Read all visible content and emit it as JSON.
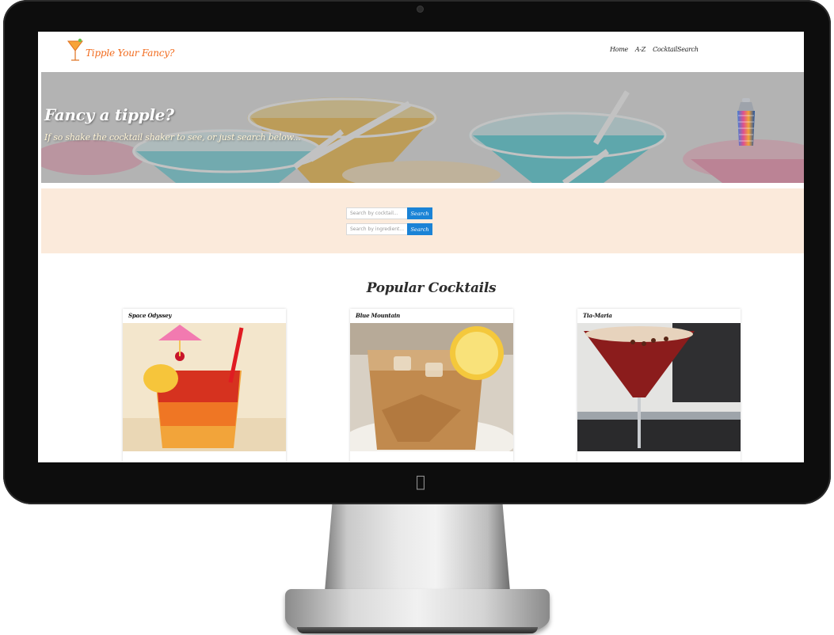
{
  "brand": {
    "logo_text": "Tipple Your Fancy?",
    "accent": "#f26b1d"
  },
  "nav": {
    "items": [
      "Home",
      "A-Z",
      "CocktailSearch"
    ]
  },
  "hero": {
    "title": "Fancy a tipple?",
    "subtitle": "If so shake the cocktail shaker to see, or just search below..."
  },
  "search": {
    "cocktail_placeholder": "Search by cocktail...",
    "ingredient_placeholder": "Search by ingredient...",
    "button_label": "Search",
    "button_color": "#1a83d6",
    "band_color": "#fbeadb"
  },
  "popular": {
    "heading": "Popular Cocktails",
    "cards": [
      {
        "title": "Space Odyssey"
      },
      {
        "title": "Blue Mountain"
      },
      {
        "title": "Tia-Maria"
      }
    ]
  },
  "icons": {
    "logo": "cocktail-glass-icon",
    "shaker": "cocktail-shaker-icon",
    "device_logo": "apple-logo-icon"
  }
}
